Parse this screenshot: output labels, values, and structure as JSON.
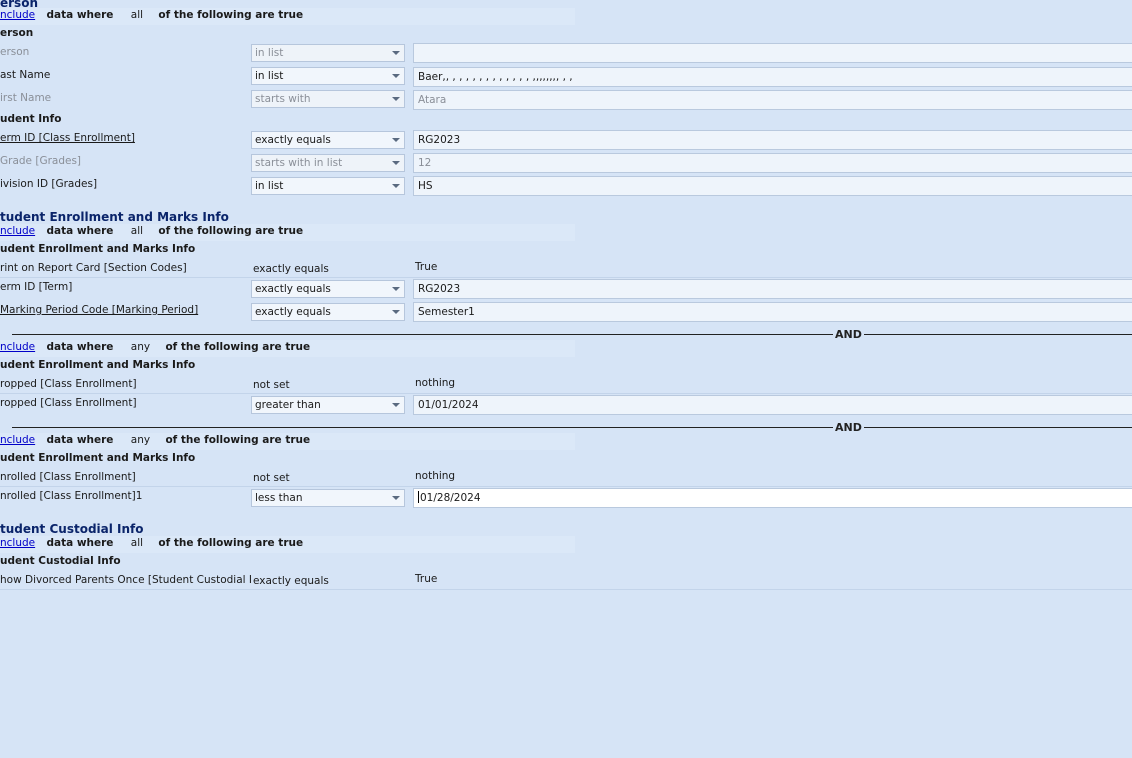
{
  "sections": {
    "person": {
      "title": "erson",
      "include": {
        "link": "nclude",
        "data_where": "data where",
        "quantifier": "all",
        "suffix": "of the following are true"
      },
      "group_person": "erson",
      "rows": [
        {
          "label": "erson",
          "operator": "in list",
          "value": ""
        },
        {
          "label": "ast Name",
          "operator": "in list",
          "value": "Baer,, , , , , , , , , , , , , ,,,,,,,, , ,"
        },
        {
          "label": "irst Name",
          "operator": "starts with",
          "value": "Atara"
        }
      ],
      "group_student": "udent Info",
      "rows2": [
        {
          "label": "erm ID [Class Enrollment]",
          "operator": "exactly equals",
          "value": "RG2023"
        },
        {
          "label": "Grade  [Grades]",
          "operator": "starts with in list",
          "value": "12"
        },
        {
          "label": "ivision ID [Grades]",
          "operator": "in list",
          "value": "HS"
        }
      ]
    },
    "enrollment": {
      "title": "tudent Enrollment and Marks Info",
      "include": {
        "link": "nclude",
        "data_where": "data where",
        "quantifier": "all",
        "suffix": "of the following are true"
      },
      "group": "udent Enrollment and Marks Info",
      "rows": [
        {
          "label": "rint on Report Card [Section Codes]",
          "operator": "exactly equals",
          "value": "True"
        },
        {
          "label": "erm ID [Term]",
          "operator": "exactly equals",
          "value": "RG2023"
        },
        {
          "label": "Marking Period Code [Marking Period]",
          "operator": "exactly equals",
          "value": "Semester1"
        }
      ],
      "and1": "AND",
      "include2": {
        "link": "nclude",
        "data_where": "data where",
        "quantifier": "any",
        "suffix": "of the following are true"
      },
      "group2": "udent Enrollment and Marks Info",
      "rows2": [
        {
          "label": "ropped [Class Enrollment]",
          "operator": "not set",
          "value": "nothing"
        },
        {
          "label": "ropped [Class Enrollment]",
          "operator": "greater than",
          "value": "01/01/2024"
        }
      ],
      "and2": "AND",
      "include3": {
        "link": "nclude",
        "data_where": "data where",
        "quantifier": "any",
        "suffix": "of the following are true"
      },
      "group3": "udent Enrollment and Marks Info",
      "rows3": [
        {
          "label": "nrolled [Class Enrollment]",
          "operator": "not set",
          "value": "nothing"
        },
        {
          "label": "nrolled [Class Enrollment]1",
          "operator": "less than",
          "value": "01/28/2024"
        }
      ]
    },
    "custodial": {
      "title": "tudent Custodial Info",
      "include": {
        "link": "nclude",
        "data_where": "data where",
        "quantifier": "all",
        "suffix": "of the following are true"
      },
      "group": "udent Custodial Info",
      "rows": [
        {
          "label": "how Divorced Parents Once [Student Custodial I",
          "operator": "exactly equals",
          "value": "True"
        }
      ]
    }
  }
}
